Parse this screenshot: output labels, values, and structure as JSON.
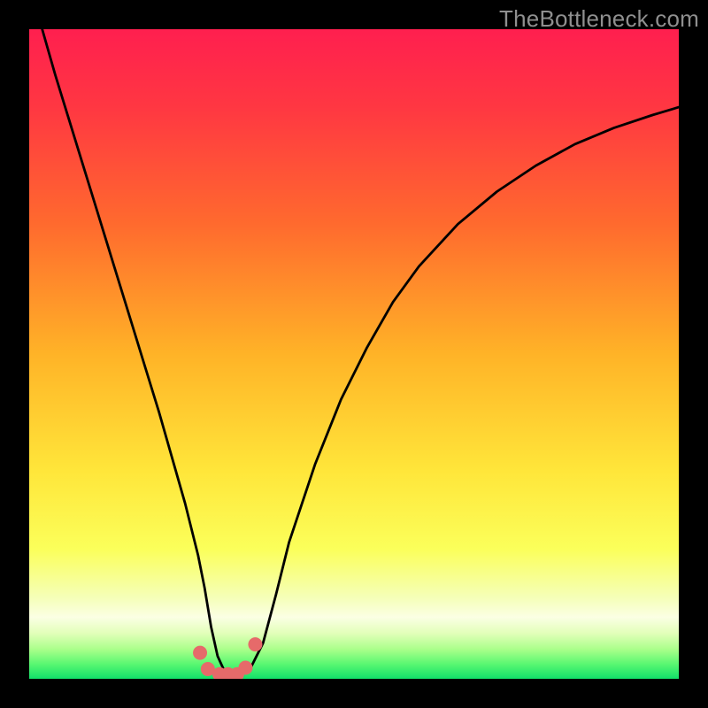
{
  "watermark": "TheBottleneck.com",
  "colors": {
    "frame": "#000000",
    "curve": "#000000",
    "marker": "#e66a6a",
    "gradient_stops": [
      {
        "offset": 0.0,
        "color": "#ff1f4f"
      },
      {
        "offset": 0.12,
        "color": "#ff3742"
      },
      {
        "offset": 0.3,
        "color": "#ff6a2e"
      },
      {
        "offset": 0.5,
        "color": "#ffb327"
      },
      {
        "offset": 0.68,
        "color": "#ffe63a"
      },
      {
        "offset": 0.8,
        "color": "#fbff5a"
      },
      {
        "offset": 0.875,
        "color": "#f5ffb8"
      },
      {
        "offset": 0.905,
        "color": "#fbffe4"
      },
      {
        "offset": 0.93,
        "color": "#e2ffb9"
      },
      {
        "offset": 0.955,
        "color": "#a9ff8a"
      },
      {
        "offset": 0.978,
        "color": "#57f771"
      },
      {
        "offset": 1.0,
        "color": "#12e06a"
      }
    ]
  },
  "chart_data": {
    "type": "line",
    "title": "",
    "xlabel": "",
    "ylabel": "",
    "xlim": [
      0,
      100
    ],
    "ylim": [
      0,
      100
    ],
    "grid": false,
    "series": [
      {
        "name": "bottleneck-curve",
        "x": [
          2,
          4,
          6,
          8,
          10,
          12,
          14,
          16,
          18,
          20,
          22,
          24,
          26,
          27,
          28,
          29,
          30,
          32,
          34,
          36,
          38,
          40,
          44,
          48,
          52,
          56,
          60,
          66,
          72,
          78,
          84,
          90,
          96,
          100
        ],
        "y": [
          100,
          93,
          86.5,
          80,
          73.5,
          67,
          60.5,
          54,
          47.5,
          41,
          34,
          27,
          19,
          14,
          8,
          3.5,
          1.3,
          0.6,
          1.5,
          5.5,
          13,
          21,
          33,
          43,
          51,
          58,
          63.5,
          70,
          75,
          79,
          82.3,
          84.8,
          86.8,
          88
        ]
      }
    ],
    "markers": {
      "name": "highlight-points",
      "x": [
        26.3,
        27.5,
        29.3,
        30.6,
        32.0,
        33.3,
        34.8
      ],
      "y": [
        4.0,
        1.5,
        0.7,
        0.7,
        0.7,
        1.7,
        5.3
      ]
    }
  }
}
